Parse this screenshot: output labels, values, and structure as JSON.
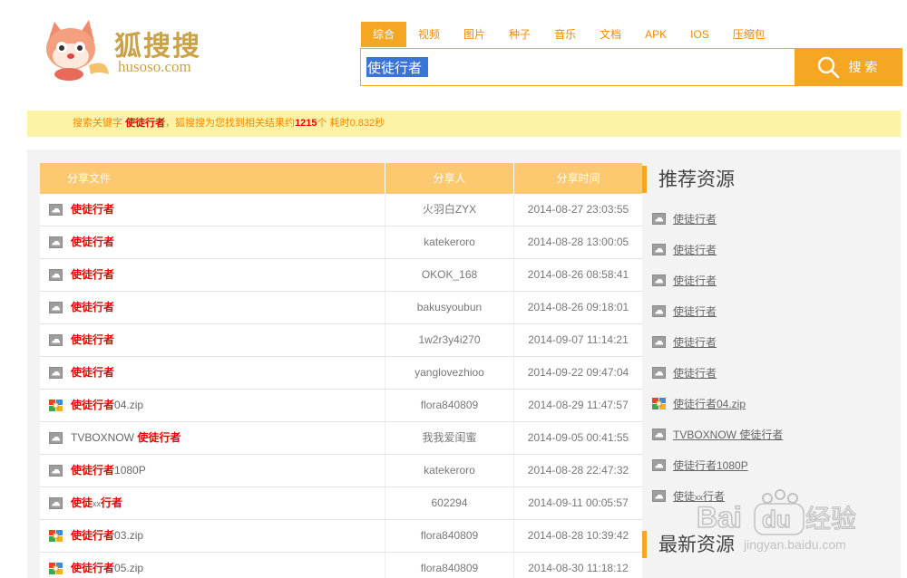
{
  "header": {
    "logo_cn": "狐搜搜",
    "logo_url": "husoso.com",
    "tabs": [
      "综合",
      "视频",
      "图片",
      "种子",
      "音乐",
      "文档",
      "APK",
      "IOS",
      "压缩包"
    ],
    "active_tab": 0,
    "search_value": "使徒行者",
    "search_button": "搜索"
  },
  "stats": {
    "prefix": "搜索关键字 ",
    "keyword": "使徒行者",
    "middle": "，狐搜搜为您找到相关结果约",
    "count": "1215",
    "suffix": "个  耗时0.832秒"
  },
  "table": {
    "headers": [
      "分享文件",
      "分享人",
      "分享时间"
    ],
    "rows": [
      {
        "icon": "cloud-file-icon",
        "pre": "",
        "hl": "使徒行者",
        "post": "",
        "user": "火羽白ZYX",
        "time": "2014-08-27 23:03:55"
      },
      {
        "icon": "cloud-file-icon",
        "pre": "",
        "hl": "使徒行者",
        "post": "",
        "user": "katekeroro",
        "time": "2014-08-28 13:00:05"
      },
      {
        "icon": "cloud-file-icon",
        "pre": "",
        "hl": "使徒行者",
        "post": "",
        "user": "OKOK_168",
        "time": "2014-08-26 08:58:41"
      },
      {
        "icon": "cloud-file-icon",
        "pre": "",
        "hl": "使徒行者",
        "post": "",
        "user": "bakusyoubun",
        "time": "2014-08-26 09:18:01"
      },
      {
        "icon": "cloud-file-icon",
        "pre": "",
        "hl": "使徒行者",
        "post": "",
        "user": "1w2r3y4i270",
        "time": "2014-09-07 11:14:21"
      },
      {
        "icon": "cloud-file-icon",
        "pre": "",
        "hl": "使徒行者",
        "post": "",
        "user": "yanglovezhioo",
        "time": "2014-09-22 09:47:04"
      },
      {
        "icon": "zip-file-icon",
        "pre": "",
        "hl": "使徒行者",
        "post": "04.zip",
        "user": "flora840809",
        "time": "2014-08-29 11:47:57"
      },
      {
        "icon": "cloud-file-icon",
        "pre": "TVBOXNOW ",
        "hl": "使徒行者",
        "post": "",
        "user": "我我爱闺蜜",
        "time": "2014-09-05 00:41:55"
      },
      {
        "icon": "cloud-file-icon",
        "pre": "",
        "hl": "使徒行者",
        "post": "1080P",
        "user": "katekeroro",
        "time": "2014-08-28 22:47:32"
      },
      {
        "icon": "cloud-file-icon",
        "pre": "",
        "hl": "使徒",
        "mid": "xx",
        "hl2": "行者",
        "post": "",
        "user": "602294",
        "time": "2014-09-11 00:05:57"
      },
      {
        "icon": "zip-file-icon",
        "pre": "",
        "hl": "使徒行者",
        "post": "03.zip",
        "user": "flora840809",
        "time": "2014-08-28 10:39:42"
      },
      {
        "icon": "zip-file-icon",
        "pre": "",
        "hl": "使徒行者",
        "post": "05.zip",
        "user": "flora840809",
        "time": "2014-08-30 11:18:12"
      }
    ]
  },
  "sidebar": {
    "recommend_title": "推荐资源",
    "latest_title": "最新资源",
    "items": [
      {
        "icon": "cloud-file-icon",
        "text": "使徒行者"
      },
      {
        "icon": "cloud-file-icon",
        "text": "使徒行者"
      },
      {
        "icon": "cloud-file-icon",
        "text": "使徒行者"
      },
      {
        "icon": "cloud-file-icon",
        "text": "使徒行者"
      },
      {
        "icon": "cloud-file-icon",
        "text": "使徒行者"
      },
      {
        "icon": "cloud-file-icon",
        "text": "使徒行者"
      },
      {
        "icon": "zip-file-icon",
        "text": "使徒行者04.zip"
      },
      {
        "icon": "cloud-file-icon",
        "text": "TVBOXNOW 使徒行者"
      },
      {
        "icon": "cloud-file-icon",
        "text": "使徒行者1080P"
      },
      {
        "icon": "cloud-file-icon",
        "text": "使徒",
        "mid": "xx",
        "text2": "行者"
      }
    ]
  },
  "watermark": {
    "text": "Bai经验",
    "url": "jingyan.baidu.com"
  },
  "colors": {
    "accent": "#f5a623",
    "highlight": "#e00000",
    "header_bg": "#fcc970",
    "stats_bg": "#fdf3a6"
  }
}
